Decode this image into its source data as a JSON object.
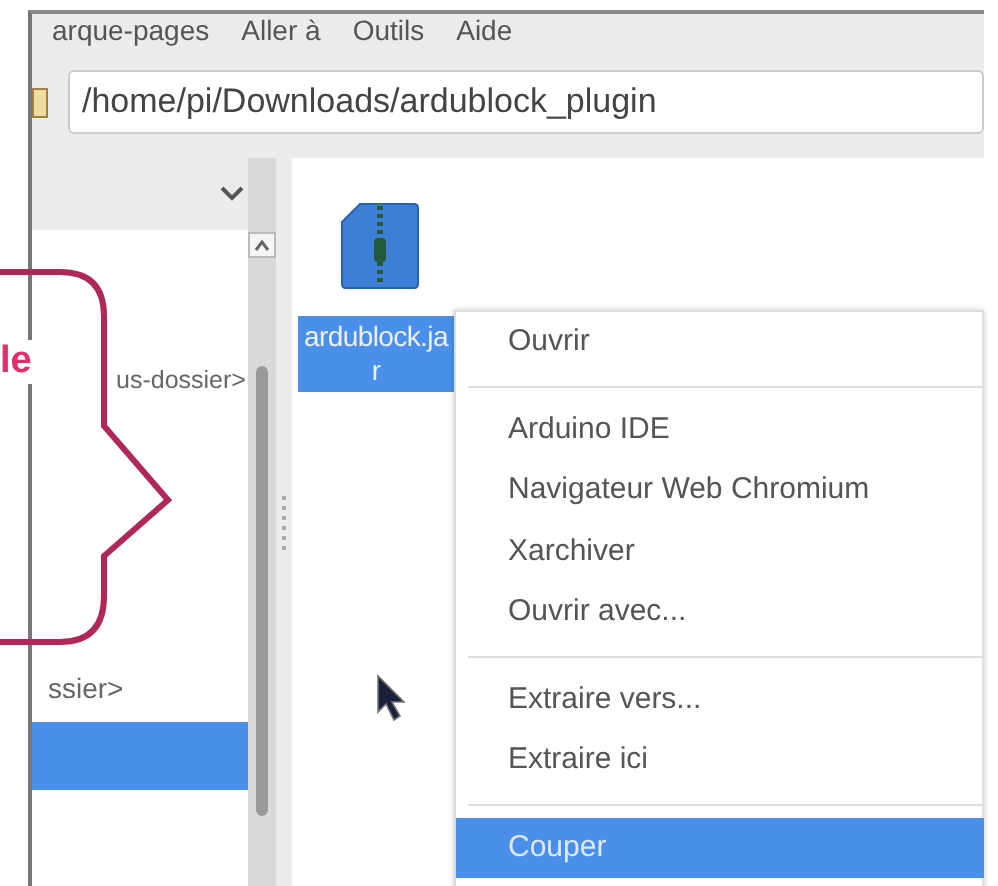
{
  "menu_bar": [
    "arque-pages",
    "Aller à",
    "Outils",
    "Aide"
  ],
  "location": {
    "value": "/home/pi/Downloads/ardublock_plugin"
  },
  "side_pane": {
    "items": [
      {
        "label": "us-dossier>",
        "selected": false
      },
      {
        "label": "ssier>",
        "selected": false
      },
      {
        "selected": true
      }
    ]
  },
  "files": [
    {
      "name_lines": [
        "ardublock.ja",
        "r"
      ],
      "selected": true
    }
  ],
  "context_menu": {
    "groups": [
      [
        {
          "label": "Ouvrir",
          "selected": false
        }
      ],
      [
        {
          "label": "Arduino IDE",
          "selected": false
        },
        {
          "label": "Navigateur Web Chromium",
          "selected": false
        },
        {
          "label": "Xarchiver",
          "selected": false
        },
        {
          "label": "Ouvrir avec...",
          "selected": false
        }
      ],
      [
        {
          "label": "Extraire vers...",
          "selected": false
        },
        {
          "label": "Extraire ici",
          "selected": false
        }
      ],
      [
        {
          "label": "Couper",
          "selected": true
        }
      ]
    ]
  },
  "callout": {
    "text": "le"
  }
}
